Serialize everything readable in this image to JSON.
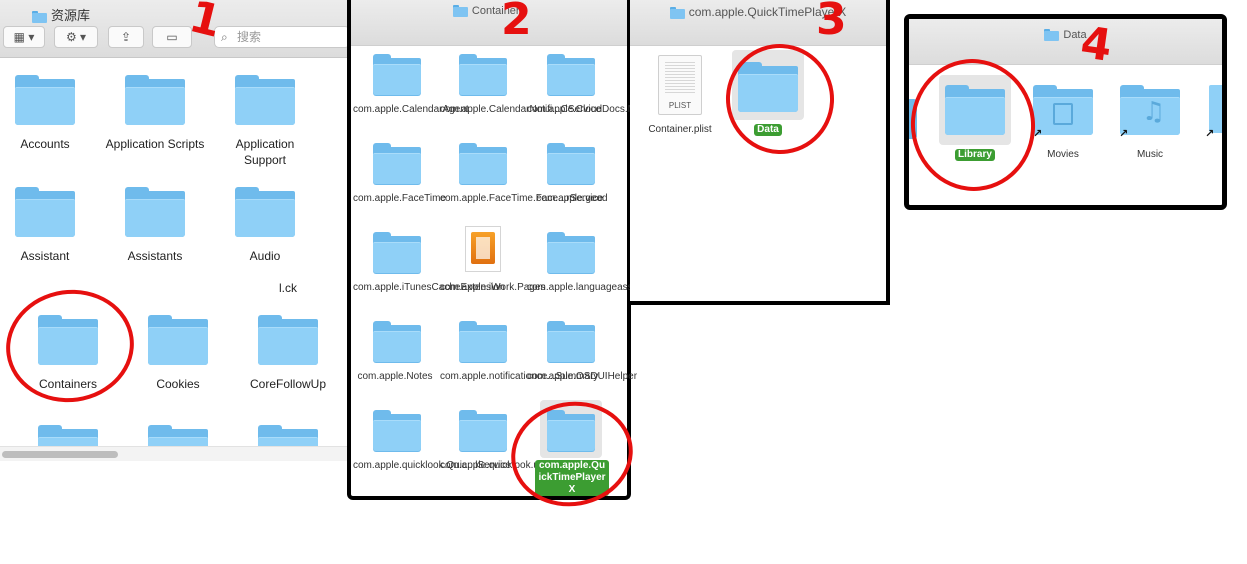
{
  "w1": {
    "title": "资源库",
    "search_placeholder": "搜索",
    "items": [
      "Accounts",
      "Application Scripts",
      "Application Support",
      "Assistant",
      "Assistants",
      "Audio",
      "Containers",
      "Cookies",
      "CoreFollowUp"
    ],
    "stray_label": "l.ck"
  },
  "w2": {
    "title": "Containers",
    "items": [
      "com.apple.CalendarAgent",
      "com.apple.CalendarNotifi...CService",
      "com.apple.CloudDocs.M...Provider",
      "com.apple.FaceTime",
      "com.apple.FaceTime.Face...rService",
      "com.apple.geod",
      "com.apple.iTunesCacheExtension",
      "com.apple.iWork.Pages",
      "com.apple.languageassetd",
      "com.apple.Notes",
      "com.apple.notificationce...Summary",
      "com.apple.OSDUIHelper",
      "com.apple.quicklook.Quic...lService",
      "com.apple.quicklook.ui.helper",
      "com.apple.QuickTimePlayerX"
    ]
  },
  "w3": {
    "title": "com.apple.QuickTimePlayerX",
    "plist_icon_text": "PLIST",
    "items": [
      "Container.plist",
      "Data"
    ]
  },
  "w4": {
    "title": "Data",
    "items": [
      "Library",
      "Movies",
      "Music"
    ]
  },
  "annotations": [
    "1",
    "2",
    "3",
    "4"
  ],
  "colors": {
    "selection": "#3c9d32",
    "annotation": "#e6100f",
    "folder": "#8fd0f7"
  }
}
